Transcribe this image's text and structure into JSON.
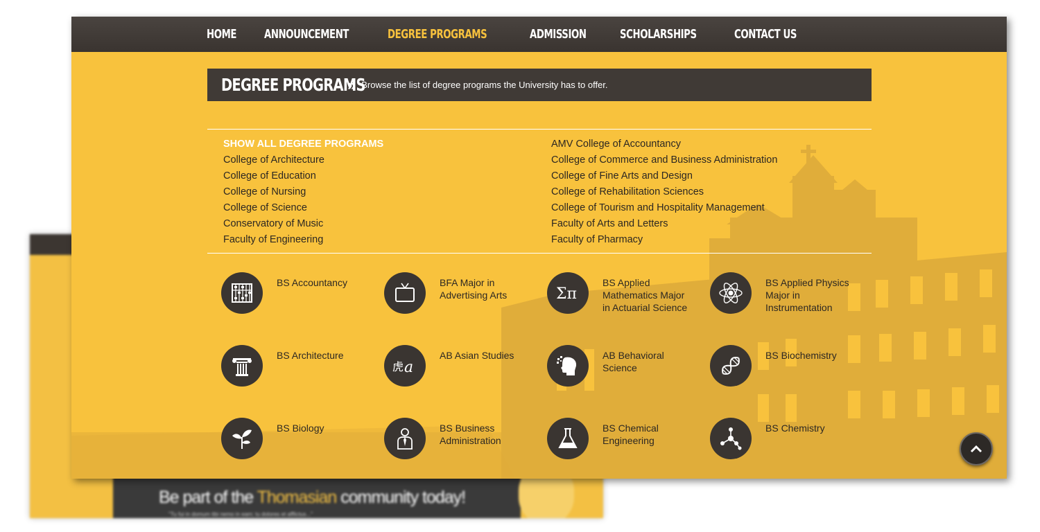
{
  "nav": {
    "items": [
      {
        "label": "HOME",
        "active": false
      },
      {
        "label": "ANNOUNCEMENT",
        "active": false
      },
      {
        "label": "DEGREE PROGRAMS",
        "active": true
      },
      {
        "label": "ADMISSION",
        "active": false
      },
      {
        "label": "SCHOLARSHIPS",
        "active": false
      },
      {
        "label": "CONTACT US",
        "active": false
      }
    ]
  },
  "header": {
    "title": "DEGREE PROGRAMS",
    "chevron": "»",
    "description": "Browse the list of degree programs the University has to offer."
  },
  "colleges": {
    "left": [
      "SHOW ALL DEGREE PROGRAMS",
      "College of Architecture",
      "College of Education",
      "College of Nursing",
      "College of Science",
      "Conservatory of Music",
      "Faculty of Engineering"
    ],
    "right": [
      "AMV College of Accountancy",
      "College of Commerce and Business Administration",
      "College of Fine Arts and Design",
      "College of Rehabilitation Sciences",
      "College of Tourism and Hospitality Management",
      "Faculty of Arts and Letters",
      "Faculty of Pharmacy"
    ]
  },
  "programs": [
    {
      "label": "BS Accountancy",
      "icon": "abacus-icon"
    },
    {
      "label": "BFA Major in Advertising Arts",
      "icon": "tv-icon"
    },
    {
      "label": "BS Applied Mathematics Major in Actuarial Science",
      "icon": "sigma-pi-icon"
    },
    {
      "label": "BS Applied Physics Major in Instrumentation",
      "icon": "atom-icon"
    },
    {
      "label": "BS Architecture",
      "icon": "column-icon"
    },
    {
      "label": "AB Asian Studies",
      "icon": "asian-character-icon"
    },
    {
      "label": "AB Behavioral Science",
      "icon": "head-puzzle-icon"
    },
    {
      "label": "BS Biochemistry",
      "icon": "dna-icon"
    },
    {
      "label": "BS Biology",
      "icon": "plant-icon"
    },
    {
      "label": "BS Business Administration",
      "icon": "businessman-icon"
    },
    {
      "label": "BS Chemical Engineering",
      "icon": "flask-icon"
    },
    {
      "label": "BS Chemistry",
      "icon": "molecule-icon"
    }
  ],
  "background_page": {
    "headline_pre": "Be part of the ",
    "headline_highlight": "Thomasian",
    "headline_post": " community today!",
    "subtitle": "\"Tu fui in domum tibi nemo in eam; tu dolores et afflictus...\""
  },
  "colors": {
    "panel": "#f8c23d",
    "nav_bar": "#3a3430",
    "active_nav": "#f8c23d",
    "icon_circle": "#3a3531"
  }
}
